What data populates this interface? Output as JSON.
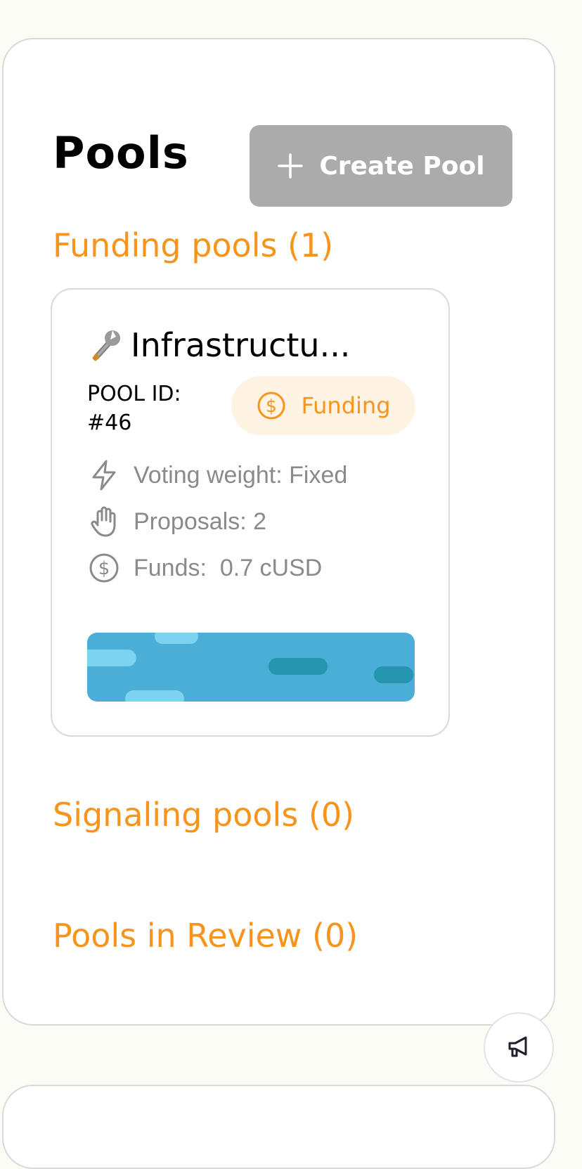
{
  "header": {
    "title": "Pools",
    "create_button_label": "Create Pool"
  },
  "sections": {
    "funding": "Funding pools (1)",
    "signaling": "Signaling pools (0)",
    "review": "Pools in Review (0)"
  },
  "pool_card": {
    "emoji": "🔧",
    "title": "Infrastructu...",
    "pool_id_label": "POOL ID:",
    "pool_id_value": "#46",
    "status": "Funding",
    "voting_weight": "Voting weight: Fixed",
    "proposals": "Proposals: 2",
    "funds": "Funds:  0.7 cUSD"
  },
  "icons": {
    "create": "plus-icon",
    "title": "wrench-icon",
    "status": "dollar-circle-icon",
    "voting": "lightning-icon",
    "proposals": "hand-icon",
    "funds": "dollar-circle-icon",
    "feedback": "megaphone-icon"
  },
  "colors": {
    "accent": "#f7941d",
    "badge_bg": "#fff3e3",
    "button_disabled": "#ababab",
    "meta_text": "#8a8a8a",
    "banner": "#4aaed6",
    "page_bg": "#fbfcf6"
  }
}
